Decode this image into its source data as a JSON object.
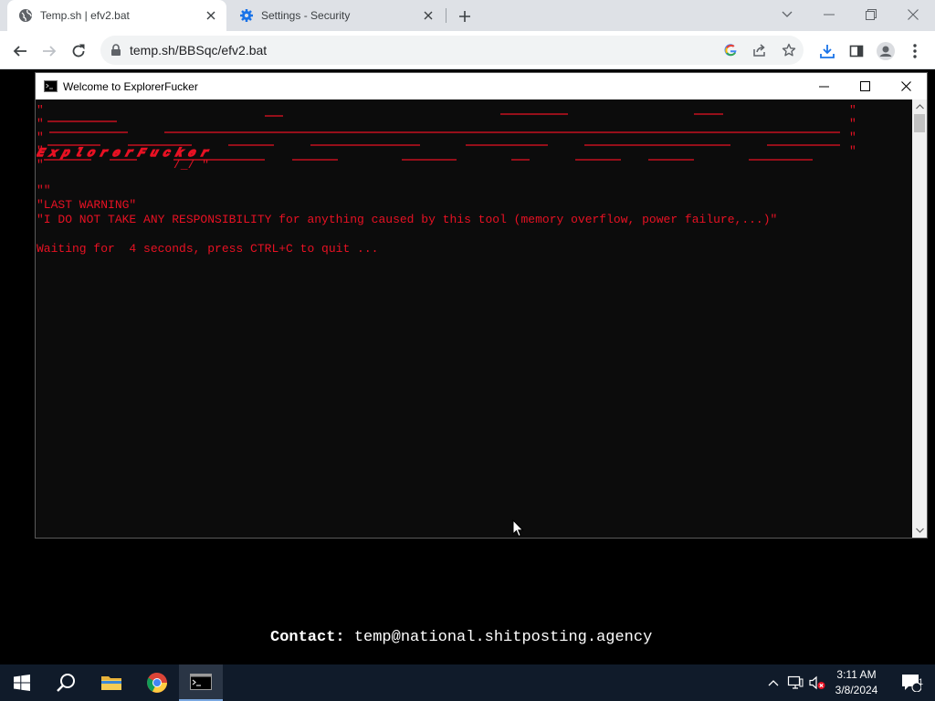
{
  "browser": {
    "tabs": [
      {
        "title": "Temp.sh | efv2.bat",
        "active": true,
        "icon": "globe-icon"
      },
      {
        "title": "Settings - Security",
        "active": false,
        "icon": "gear-icon"
      }
    ],
    "address": {
      "url": "temp.sh/BBSqc/efv2.bat"
    }
  },
  "console": {
    "title": "Welcome to ExplorerFucker",
    "banner_text": "ExplorerFucker",
    "lines": [
      "\"\"",
      "\"LAST WARNING\"",
      "\"I DO NOT TAKE ANY RESPONSIBILITY for anything caused by this tool (memory overflow, power failure,...)\"",
      "",
      "Waiting for  4 seconds, press CTRL+C to quit ..."
    ]
  },
  "desktop": {
    "contact_label": "Contact:",
    "contact_email": "temp@national.shitposting.agency"
  },
  "taskbar": {
    "clock_time": "3:11 AM",
    "clock_date": "3/8/2024",
    "notification_count": "1"
  },
  "colors": {
    "console_text": "#e81123",
    "console_bg": "#0c0c0c",
    "taskbar_bg": "#101b2a",
    "chrome_tabstrip": "#dee1e6"
  }
}
